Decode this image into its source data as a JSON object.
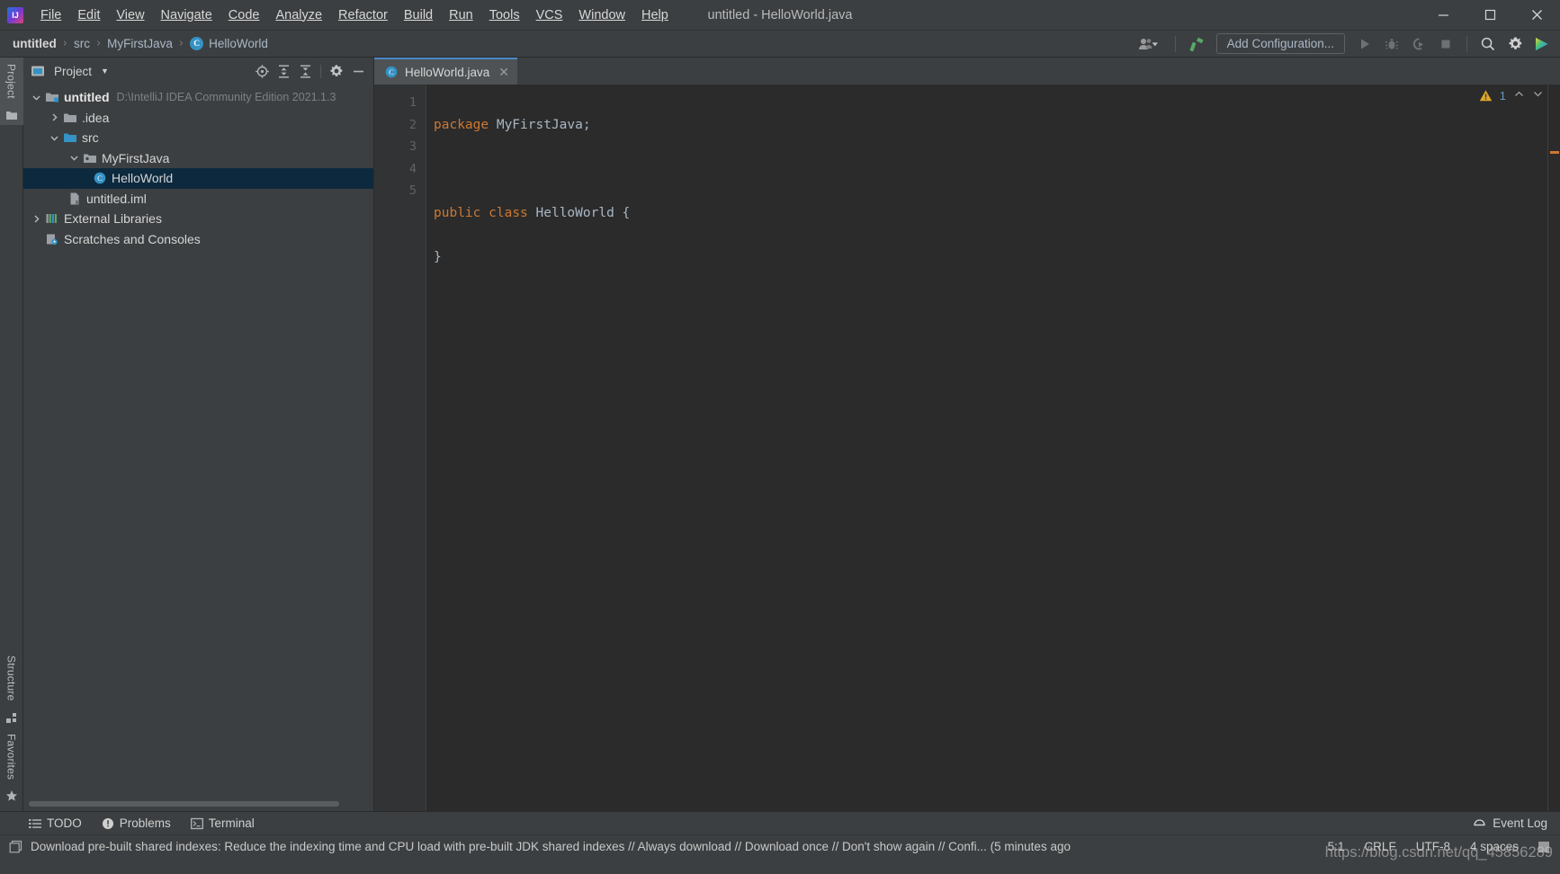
{
  "window": {
    "title": "untitled - HelloWorld.java",
    "logo_icon": "intellij-idea-logo",
    "minimize_label": "Minimize",
    "maximize_label": "Maximize",
    "close_label": "Close"
  },
  "menu": {
    "items": [
      {
        "label": "File",
        "mnemonic": "F"
      },
      {
        "label": "Edit",
        "mnemonic": "E"
      },
      {
        "label": "View",
        "mnemonic": "V"
      },
      {
        "label": "Navigate",
        "mnemonic": "N"
      },
      {
        "label": "Code",
        "mnemonic": "C"
      },
      {
        "label": "Analyze",
        "mnemonic": "z"
      },
      {
        "label": "Refactor",
        "mnemonic": "R"
      },
      {
        "label": "Build",
        "mnemonic": "B"
      },
      {
        "label": "Run",
        "mnemonic": "u"
      },
      {
        "label": "Tools",
        "mnemonic": "T"
      },
      {
        "label": "VCS",
        "mnemonic": "S"
      },
      {
        "label": "Window",
        "mnemonic": "W"
      },
      {
        "label": "Help",
        "mnemonic": "H"
      }
    ]
  },
  "toolbar": {
    "breadcrumb": [
      {
        "label": "untitled",
        "bold": true,
        "icon": null
      },
      {
        "label": "src",
        "bold": false,
        "icon": null
      },
      {
        "label": "MyFirstJava",
        "bold": false,
        "icon": null
      },
      {
        "label": "HelloWorld",
        "bold": false,
        "icon": "class-badge"
      }
    ],
    "separator": "›",
    "class_badge_letter": "C",
    "user_icon": "user-account-icon",
    "build_icon": "build-hammer-icon",
    "add_configuration_label": "Add Configuration...",
    "run_icon": "run-play-icon",
    "debug_icon": "debug-bug-icon",
    "run_coverage_icon": "run-with-coverage-icon",
    "stop_icon": "stop-square-icon",
    "search_icon": "search-everywhere-icon",
    "settings_icon": "settings-gear-icon",
    "toolbox_icon": "jetbrains-toolbox-icon"
  },
  "rail": {
    "top": [
      {
        "label": "Project",
        "icon": "project-folder-icon",
        "active": true
      }
    ],
    "bottom": [
      {
        "label": "Structure",
        "icon": "structure-icon",
        "active": false
      },
      {
        "label": "Favorites",
        "icon": "favorites-star-icon",
        "active": false
      }
    ]
  },
  "project_panel": {
    "title": "Project",
    "dropdown_caret": "▼",
    "tools": [
      {
        "name": "select-opened-file-icon",
        "label": "Select Opened File"
      },
      {
        "name": "expand-all-icon",
        "label": "Expand All"
      },
      {
        "name": "collapse-all-icon",
        "label": "Collapse All"
      },
      {
        "name": "options-gear-icon",
        "label": "Options"
      },
      {
        "name": "hide-icon",
        "label": "Hide"
      }
    ],
    "tree": [
      {
        "label": "untitled",
        "path": "D:\\IntelliJ IDEA Community Edition 2021.1.3",
        "depth": 0,
        "arrow": "expanded",
        "icon": "module-folder-icon",
        "bold": true,
        "selected": false
      },
      {
        "label": ".idea",
        "path": "",
        "depth": 1,
        "arrow": "collapsed",
        "icon": "folder-icon",
        "bold": false,
        "selected": false
      },
      {
        "label": "src",
        "path": "",
        "depth": 1,
        "arrow": "expanded",
        "icon": "source-folder-icon",
        "bold": false,
        "selected": false
      },
      {
        "label": "MyFirstJava",
        "path": "",
        "depth": 2,
        "arrow": "expanded",
        "icon": "package-icon",
        "bold": false,
        "selected": false
      },
      {
        "label": "HelloWorld",
        "path": "",
        "depth": 3,
        "arrow": "none",
        "icon": "java-class-icon",
        "bold": false,
        "selected": true
      },
      {
        "label": "untitled.iml",
        "path": "",
        "depth": 1,
        "arrow": "none",
        "icon": "iml-file-icon",
        "bold": false,
        "selected": false
      },
      {
        "label": "External Libraries",
        "path": "",
        "depth": 0,
        "arrow": "collapsed",
        "icon": "libraries-icon",
        "bold": false,
        "selected": false
      },
      {
        "label": "Scratches and Consoles",
        "path": "",
        "depth": 0,
        "arrow": "none",
        "icon": "scratches-icon",
        "bold": false,
        "selected": false
      }
    ]
  },
  "editor": {
    "tabs": [
      {
        "label": "HelloWorld.java",
        "icon": "java-class-icon",
        "close_icon": "close-icon",
        "active": true
      }
    ],
    "line_numbers": [
      "1",
      "2",
      "3",
      "4",
      "5"
    ],
    "lines": [
      [
        {
          "t": "package",
          "c": "k"
        },
        {
          "t": " ",
          "c": "id"
        },
        {
          "t": "MyFirstJava",
          "c": "id"
        },
        {
          "t": ";",
          "c": "id"
        }
      ],
      [],
      [
        {
          "t": "public",
          "c": "k"
        },
        {
          "t": " ",
          "c": "id"
        },
        {
          "t": "class",
          "c": "k"
        },
        {
          "t": " ",
          "c": "id"
        },
        {
          "t": "HelloWorld",
          "c": "cls-name"
        },
        {
          "t": " {",
          "c": "id"
        }
      ],
      [
        {
          "t": "}",
          "c": "id"
        }
      ],
      []
    ],
    "inspection": {
      "warning_icon": "warning-triangle-icon",
      "warning_count": "1",
      "prev_icon": "⌃",
      "next_icon": "⌄"
    }
  },
  "toolwindow_bar": {
    "items": [
      {
        "label": "TODO",
        "icon": "todo-list-icon"
      },
      {
        "label": "Problems",
        "icon": "problems-icon"
      },
      {
        "label": "Terminal",
        "icon": "terminal-icon"
      }
    ],
    "event_log": {
      "label": "Event Log",
      "icon": "event-log-icon"
    }
  },
  "statusbar": {
    "message_icon": "notification-icon",
    "message": "Download pre-built shared indexes: Reduce the indexing time and CPU load with pre-built JDK shared indexes // Always download // Download once // Don't show again // Confi... (5 minutes ago",
    "caret_position": "5:1",
    "line_separator": "CRLF",
    "encoding": "UTF-8",
    "indent": "4 spaces",
    "lock_icon": "write-access-icon"
  },
  "watermark": {
    "text": "https://blog.csdn.net/qq_45856289"
  },
  "colors": {
    "chrome": "#3c3f41",
    "editor_bg": "#2b2b2b",
    "gutter_bg": "#313335",
    "selection": "#0d293e",
    "keyword": "#cc7832",
    "text": "#a9b7c6",
    "accent": "#4a88c7",
    "badge": "#3592c4",
    "warning": "#e0a826"
  }
}
